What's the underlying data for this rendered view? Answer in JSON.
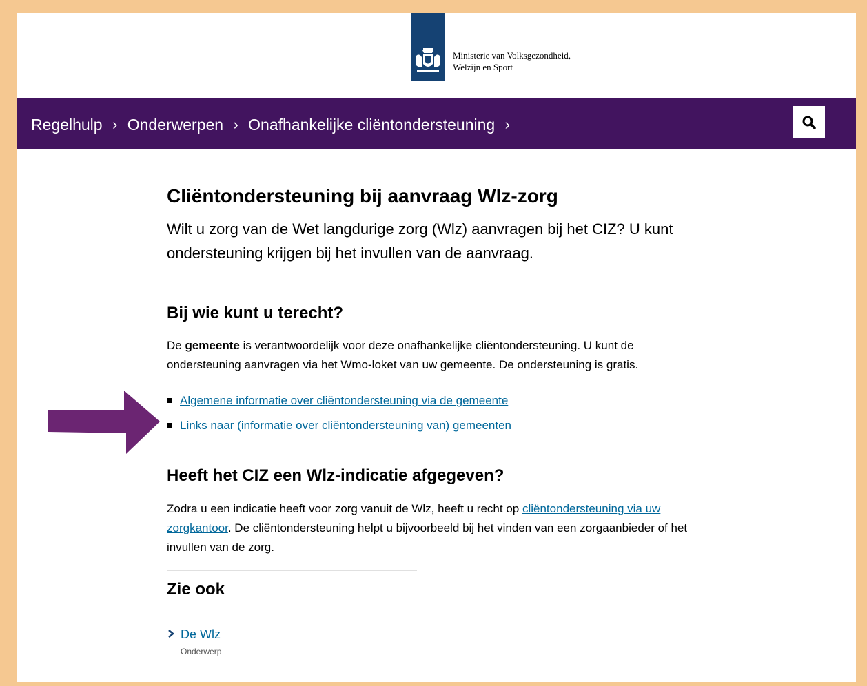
{
  "logo": {
    "line1": "Ministerie van Volksgezondheid,",
    "line2": "Welzijn en Sport",
    "brand_color": "#154273"
  },
  "nav": {
    "background": "#42145f",
    "breadcrumbs": [
      "Regelhulp",
      "Onderwerpen",
      "Onafhankelijke cliëntondersteuning"
    ],
    "separator": "›",
    "search_icon": "search-icon"
  },
  "main": {
    "title": "Cliëntondersteuning bij aanvraag Wlz-zorg",
    "lead": "Wilt u zorg van de Wet langdurige zorg (Wlz) aanvragen bij het CIZ? U kunt ondersteuning krijgen bij het invullen van de aanvraag.",
    "section1": {
      "heading": "Bij wie kunt u terecht?",
      "p_before": "De ",
      "p_bold": "gemeente",
      "p_after": " is verantwoordelijk voor deze onafhankelijke cliëntondersteuning. U kunt de ondersteuning aanvragen via het Wmo-loket van uw gemeente. De ondersteuning is  gratis.",
      "links": [
        "Algemene informatie over cliëntondersteuning via de gemeente",
        "Links naar (informatie over cliëntondersteuning van) gemeenten"
      ]
    },
    "section2": {
      "heading": "Heeft het CIZ een Wlz-indicatie afgegeven?",
      "p_before": "Zodra u een indicatie heeft voor zorg vanuit de Wlz, heeft u recht op ",
      "p_link": "cliëntondersteuning via uw zorgkantoor",
      "p_after": ". De cliëntondersteuning helpt u bijvoorbeeld bij het vinden van een zorgaanbieder of het invullen van de zorg."
    },
    "see_also": {
      "heading": "Zie ook",
      "item_label": "De Wlz",
      "item_type": "Onderwerp"
    }
  },
  "annotation": {
    "arrow_color": "#6b2572"
  }
}
